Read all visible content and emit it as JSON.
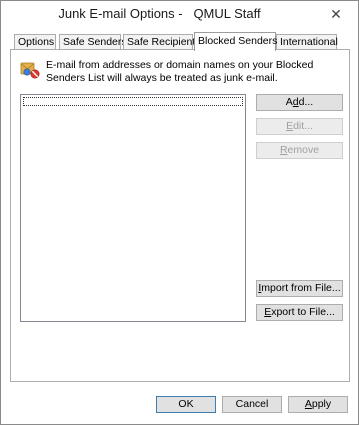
{
  "window": {
    "title": "Junk E-mail Options -   QMUL Staff",
    "close_glyph": "✕"
  },
  "tabs": [
    {
      "label": "Options",
      "active": false
    },
    {
      "label": "Safe Senders",
      "active": false
    },
    {
      "label": "Safe Recipients",
      "active": false
    },
    {
      "label": "Blocked Senders",
      "active": true
    },
    {
      "label": "International",
      "active": false
    }
  ],
  "panel": {
    "icon": "blocked-senders-icon",
    "description": "E-mail from addresses or domain names on your Blocked Senders List will always be treated as junk e-mail.",
    "list_items": []
  },
  "buttons": {
    "add": {
      "pre": "A",
      "accel": "d",
      "post": "d...",
      "enabled": true
    },
    "edit": {
      "pre": "",
      "accel": "E",
      "post": "dit...",
      "enabled": false
    },
    "remove": {
      "pre": "",
      "accel": "R",
      "post": "emove",
      "enabled": false
    },
    "import": {
      "pre": "",
      "accel": "I",
      "post": "mport from File...",
      "enabled": true
    },
    "export": {
      "pre": "",
      "accel": "E",
      "post": "xport to File...",
      "enabled": true
    }
  },
  "footer": {
    "ok": "OK",
    "cancel": "Cancel",
    "apply": {
      "pre": "",
      "accel": "A",
      "post": "pply"
    }
  },
  "colors": {
    "default_button_border": "#3c7fb1",
    "disabled_text": "#a0a0a0"
  }
}
